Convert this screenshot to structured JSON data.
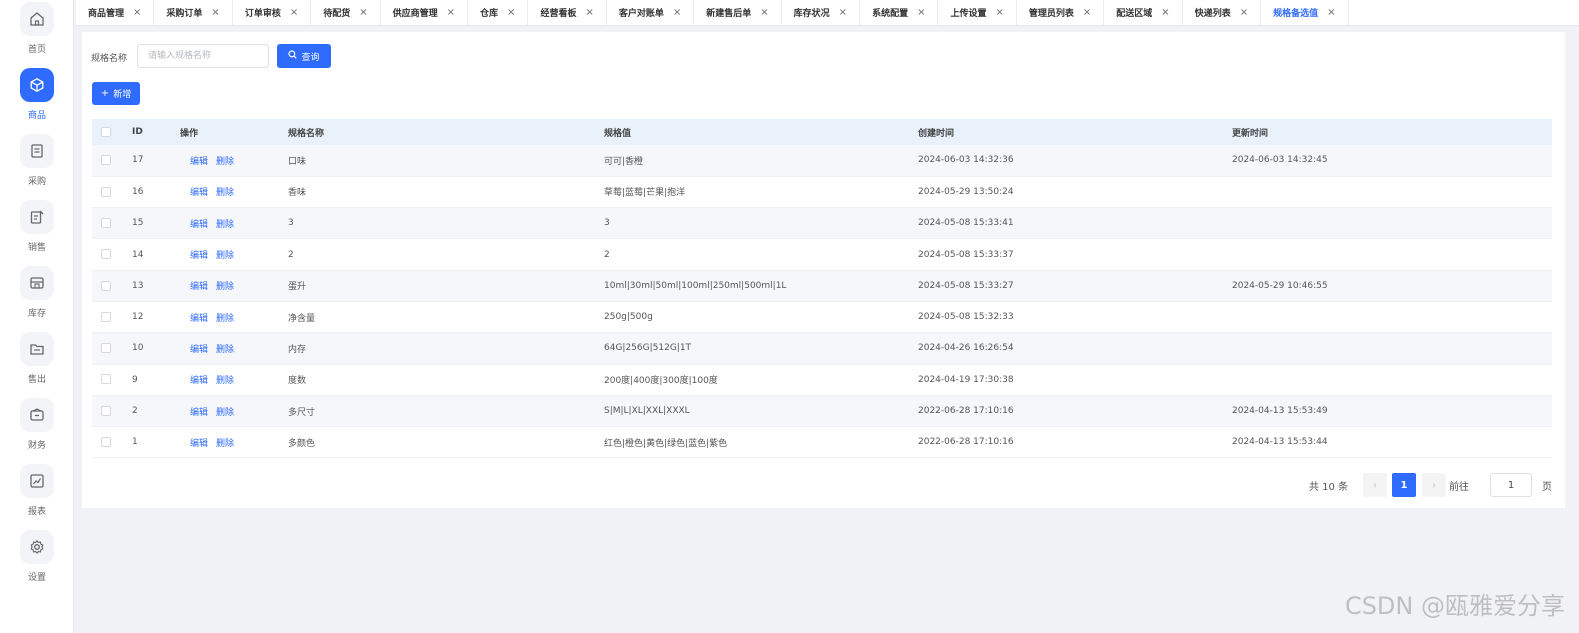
{
  "sidebar": {
    "items": [
      {
        "label": "首页",
        "icon": "home-icon"
      },
      {
        "label": "商品",
        "icon": "cube-icon",
        "active": true
      },
      {
        "label": "采购",
        "icon": "list-icon"
      },
      {
        "label": "销售",
        "icon": "edit-icon"
      },
      {
        "label": "库存",
        "icon": "store-icon"
      },
      {
        "label": "售出",
        "icon": "folder-icon"
      },
      {
        "label": "财务",
        "icon": "wallet-icon"
      },
      {
        "label": "报表",
        "icon": "chart-icon"
      },
      {
        "label": "设置",
        "icon": "gear-icon"
      }
    ]
  },
  "tabs": [
    {
      "label": "商品管理"
    },
    {
      "label": "采购订单"
    },
    {
      "label": "订单审核"
    },
    {
      "label": "待配货"
    },
    {
      "label": "供应商管理"
    },
    {
      "label": "仓库"
    },
    {
      "label": "经营看板"
    },
    {
      "label": "客户对账单"
    },
    {
      "label": "新建售后单"
    },
    {
      "label": "库存状况"
    },
    {
      "label": "系统配置"
    },
    {
      "label": "上传设置"
    },
    {
      "label": "管理员列表"
    },
    {
      "label": "配送区域"
    },
    {
      "label": "快递列表"
    },
    {
      "label": "规格备选值",
      "active": true
    }
  ],
  "tab_close": "×",
  "search": {
    "label": "规格名称",
    "placeholder": "请输入规格名称",
    "button": "查询"
  },
  "add_button": "新增",
  "table": {
    "headers": [
      "ID",
      "操作",
      "规格名称",
      "规格值",
      "创建时间",
      "更新时间"
    ],
    "edit_label": "编辑",
    "delete_label": "删除",
    "rows": [
      {
        "id": "17",
        "name": "口味",
        "value": "可可|香橙",
        "created": "2024-06-03 14:32:36",
        "updated": "2024-06-03 14:32:45"
      },
      {
        "id": "16",
        "name": "香味",
        "value": "草莓|蓝莓|芒果|抱洋",
        "created": "2024-05-29 13:50:24",
        "updated": ""
      },
      {
        "id": "15",
        "name": "3",
        "value": "3",
        "created": "2024-05-08 15:33:41",
        "updated": ""
      },
      {
        "id": "14",
        "name": "2",
        "value": "2",
        "created": "2024-05-08 15:33:37",
        "updated": ""
      },
      {
        "id": "13",
        "name": "蛋升",
        "value": "10ml|30ml|50ml|100ml|250ml|500ml|1L",
        "created": "2024-05-08 15:33:27",
        "updated": "2024-05-29 10:46:55"
      },
      {
        "id": "12",
        "name": "净含量",
        "value": "250g|500g",
        "created": "2024-05-08 15:32:33",
        "updated": ""
      },
      {
        "id": "10",
        "name": "内存",
        "value": "64G|256G|512G|1T",
        "created": "2024-04-26 16:26:54",
        "updated": ""
      },
      {
        "id": "9",
        "name": "度数",
        "value": "200度|400度|300度|100度",
        "created": "2024-04-19 17:30:38",
        "updated": ""
      },
      {
        "id": "2",
        "name": "多尺寸",
        "value": "S|M|L|XL|XXL|XXXL",
        "created": "2022-06-28 17:10:16",
        "updated": "2024-04-13 15:53:49"
      },
      {
        "id": "1",
        "name": "多颜色",
        "value": "红色|橙色|黄色|绿色|蓝色|紫色",
        "created": "2022-06-28 17:10:16",
        "updated": "2024-04-13 15:53:44"
      }
    ]
  },
  "pagination": {
    "total": "共 10 条",
    "prev": "‹",
    "current": "1",
    "next": "›",
    "goto_label": "前往",
    "goto_value": "1",
    "unit": "页"
  },
  "watermark": "CSDN @瓯雅爱分享"
}
